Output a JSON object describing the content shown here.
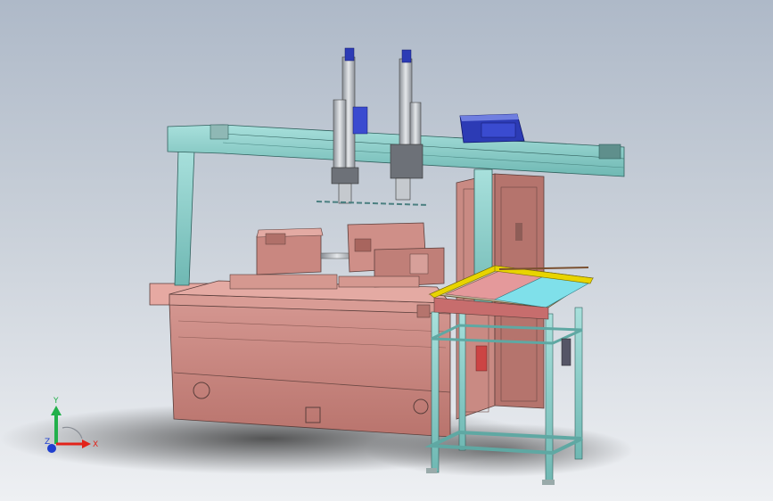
{
  "triad": {
    "x_label": "X",
    "y_label": "Y",
    "z_label": "Z",
    "x_color": "#e2231a",
    "y_color": "#22b04b",
    "z_color": "#1f3fcf"
  },
  "colors": {
    "frame_teal": "#8fd0cc",
    "machine_pink": "#c9857e",
    "machine_pink_light": "#e0a6a0",
    "motor_blue": "#2c3bb5",
    "accent_yellow": "#e8d400",
    "tray_cyan": "#7fe0ea"
  }
}
